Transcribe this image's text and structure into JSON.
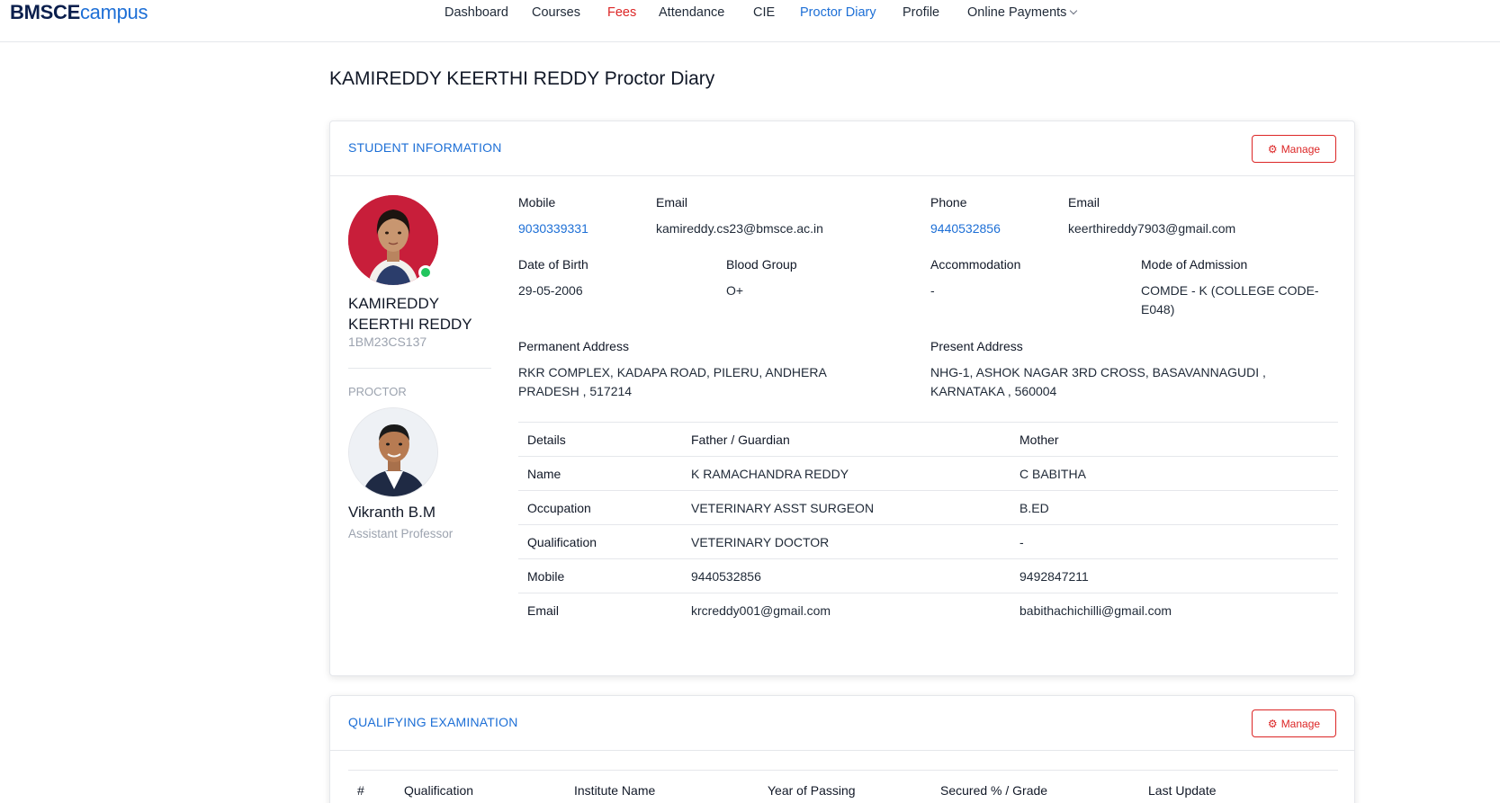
{
  "brand": {
    "part1": "BMSCE",
    "part2": "campus"
  },
  "nav": {
    "items": [
      {
        "label": "Dashboard"
      },
      {
        "label": "Courses"
      },
      {
        "label": "Fees"
      },
      {
        "label": "Attendance"
      },
      {
        "label": "CIE"
      },
      {
        "label": "Proctor Diary"
      },
      {
        "label": "Profile"
      },
      {
        "label": "Online Payments"
      }
    ],
    "active": "Proctor Diary"
  },
  "page": {
    "title": "KAMIREDDY KEERTHI REDDY Proctor Diary"
  },
  "student_info": {
    "section_title": "STUDENT INFORMATION",
    "manage_label": "Manage",
    "student": {
      "name": "KAMIREDDY KEERTHI REDDY",
      "usn": "1BM23CS137"
    },
    "proctor": {
      "section_label": "PROCTOR",
      "name": "Vikranth B.M",
      "designation": "Assistant Professor"
    },
    "fields": {
      "mobile_label": "Mobile",
      "mobile": "9030339331",
      "email_label": "Email",
      "email": "kamireddy.cs23@bmsce.ac.in",
      "phone_label": "Phone",
      "phone": "9440532856",
      "email2_label": "Email",
      "email2": "keerthireddy7903@gmail.com",
      "dob_label": "Date of Birth",
      "dob": "29-05-2006",
      "blood_label": "Blood Group",
      "blood": "O+",
      "accommodation_label": "Accommodation",
      "accommodation": "-",
      "admission_label": "Mode of Admission",
      "admission": "COMDE - K (COLLEGE CODE-E048)",
      "perm_addr_label": "Permanent Address",
      "perm_addr": "RKR COMPLEX, KADAPA ROAD, PILERU, ANDHERA PRADESH , 517214",
      "pres_addr_label": "Present Address",
      "pres_addr": "NHG-1, ASHOK NAGAR 3RD CROSS, BASAVANNAGUDI , KARNATAKA , 560004"
    },
    "parents_table": {
      "headers": [
        "Details",
        "Father / Guardian",
        "Mother"
      ],
      "rows": [
        [
          "Name",
          "K RAMACHANDRA REDDY",
          "C BABITHA"
        ],
        [
          "Occupation",
          "VETERINARY ASST SURGEON",
          "B.ED"
        ],
        [
          "Qualification",
          "VETERINARY DOCTOR",
          "-"
        ],
        [
          "Mobile",
          "9440532856",
          "9492847211"
        ],
        [
          "Email",
          "krcreddy001@gmail.com",
          "babithachichilli@gmail.com"
        ]
      ]
    }
  },
  "qualifying_exam": {
    "section_title": "QUALIFYING EXAMINATION",
    "manage_label": "Manage",
    "headers": [
      "#",
      "Qualification",
      "Institute Name",
      "Year of Passing",
      "Secured % / Grade",
      "Last Update"
    ]
  },
  "colors": {
    "accent": "#1d6fd6",
    "danger": "#dc2626",
    "online": "#22c55e"
  }
}
